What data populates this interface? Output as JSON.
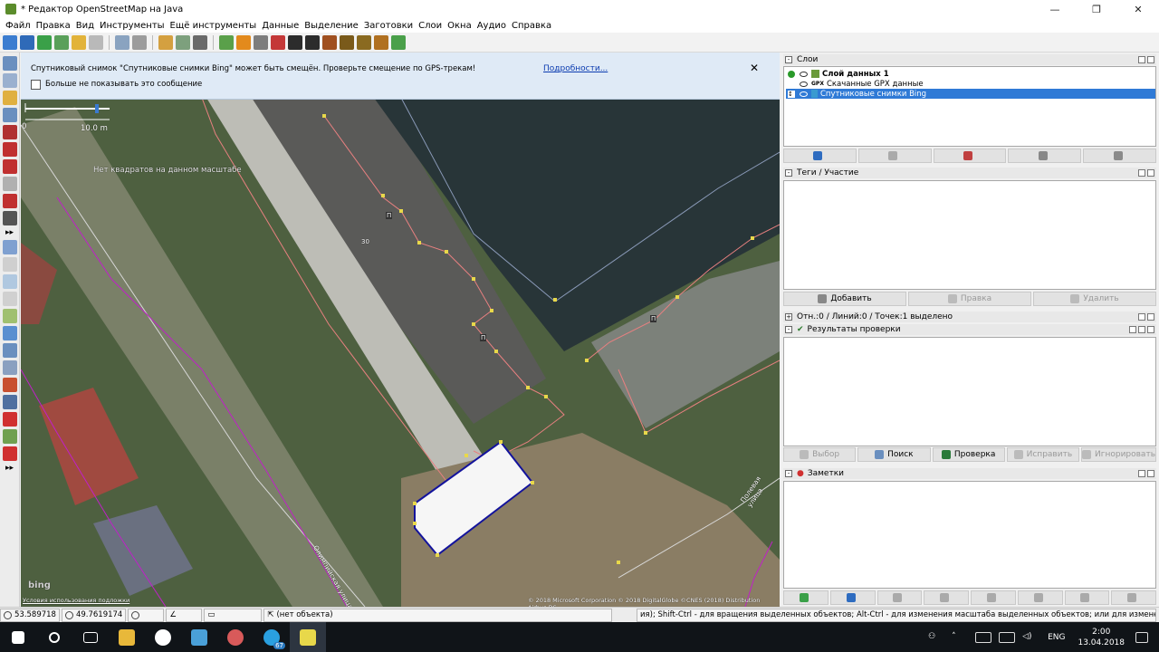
{
  "window": {
    "title": "* Редактор OpenStreetMap на Java",
    "minimize": "—",
    "maximize": "❐",
    "close": "✕"
  },
  "menu": [
    "Файл",
    "Правка",
    "Вид",
    "Инструменты",
    "Ещё инструменты",
    "Данные",
    "Выделение",
    "Заготовки",
    "Слои",
    "Окна",
    "Аудио",
    "Справка"
  ],
  "notice": {
    "message": "Спутниковый снимок \"Спутниковые снимки Bing\" может быть смещён. Проверьте смещение по GPS-трекам!",
    "link": "Подробности...",
    "close": "✕",
    "checkbox_label": "Больше не показывать это сообщение"
  },
  "map": {
    "scale_start": "0",
    "scale_label": "10.0 m",
    "no_tiles": "Нет квадратов на данном масштабе",
    "house_number": "30",
    "road_label_1": "Полевая улица",
    "road_label_2": "Олимпийская улица",
    "bing_logo": "bing",
    "terms": "Условия использования подложки",
    "attribution": "© 2018 Microsoft Corporation © 2018 DigitalGlobe ©CNES (2018) Distribution Airbus DS",
    "entrance_label": "П"
  },
  "layers_panel": {
    "title": "Слои",
    "layers": [
      {
        "name": "Слой данных 1",
        "bold": true,
        "selected": false
      },
      {
        "name": "Скачанные GPX данные",
        "bold": false,
        "selected": false
      },
      {
        "name": "Спутниковые снимки Bing",
        "bold": false,
        "selected": true
      }
    ]
  },
  "tags_panel": {
    "title": "Теги / Участие",
    "add": "Добавить",
    "edit": "Правка",
    "delete": "Удалить"
  },
  "selection_panel": {
    "title": "Отн.:0 / Линий:0 / Точек:1 выделено"
  },
  "validation_panel": {
    "title": "Результаты проверки",
    "select": "Выбор",
    "search": "Поиск",
    "validate": "Проверка",
    "fix": "Исправить",
    "ignore": "Игнорировать"
  },
  "notes_panel": {
    "title": "Заметки"
  },
  "status": {
    "lat": "53.589718",
    "lon": "49.7619174",
    "object": "(нет объекта)",
    "help": "ия); Shift-Ctrl - для вращения выделенных объектов; Alt-Ctrl - для изменения масштаба выделенных объектов; или для изменения выделения"
  },
  "taskbar": {
    "badge": "67",
    "lang": "ENG",
    "time": "2:00",
    "date": "13.04.2018"
  },
  "colors": {
    "selected_row": "#2f7ad6",
    "way_pink": "#e88080",
    "node_yellow": "#e8d84a",
    "selected_way": "#13139c",
    "gpx_magenta": "#c020c8"
  }
}
